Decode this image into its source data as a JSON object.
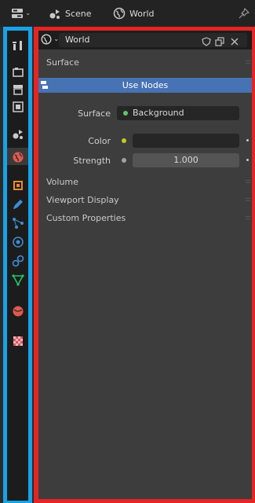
{
  "topbar": {
    "scene_label": "Scene",
    "world_label": "World"
  },
  "properties": {
    "datablock_name": "World",
    "panels": {
      "surface": "Surface",
      "use_nodes": "Use Nodes",
      "volume": "Volume",
      "viewport_display": "Viewport Display",
      "custom_properties": "Custom Properties"
    },
    "fields": {
      "surface_label": "Surface",
      "surface_value": "Background",
      "color_label": "Color",
      "strength_label": "Strength",
      "strength_value": "1.000"
    }
  },
  "colors": {
    "left_highlight": "#17a3e6",
    "panel_highlight": "#e52424",
    "use_nodes_bg": "#4772b3",
    "surface_socket": "#62c46b",
    "color_socket": "#c7c729",
    "strength_socket": "#a1a1a1"
  },
  "tabs": [
    {
      "name": "tool-tab-icon",
      "color": "#c9c9c9"
    },
    {
      "name": "render-tab-icon",
      "color": "#c9c9c9"
    },
    {
      "name": "output-tab-icon",
      "color": "#c9c9c9"
    },
    {
      "name": "view-layer-tab-icon",
      "color": "#c9c9c9"
    },
    {
      "name": "scene-tab-icon",
      "color": "#c9c9c9"
    },
    {
      "name": "world-tab-icon",
      "color": "#e05a4f"
    },
    {
      "name": "object-tab-icon",
      "color": "#e88a2e"
    },
    {
      "name": "modifier-tab-icon",
      "color": "#3c8fd9"
    },
    {
      "name": "particles-tab-icon",
      "color": "#3c8fd9"
    },
    {
      "name": "physics-tab-icon",
      "color": "#3c8fd9"
    },
    {
      "name": "constraints-tab-icon",
      "color": "#3c8fd9"
    },
    {
      "name": "object-data-tab-icon",
      "color": "#23c26b"
    },
    {
      "name": "material-tab-icon",
      "color": "#e05a4f"
    },
    {
      "name": "texture-tab-icon",
      "color": "#d0585f"
    }
  ]
}
